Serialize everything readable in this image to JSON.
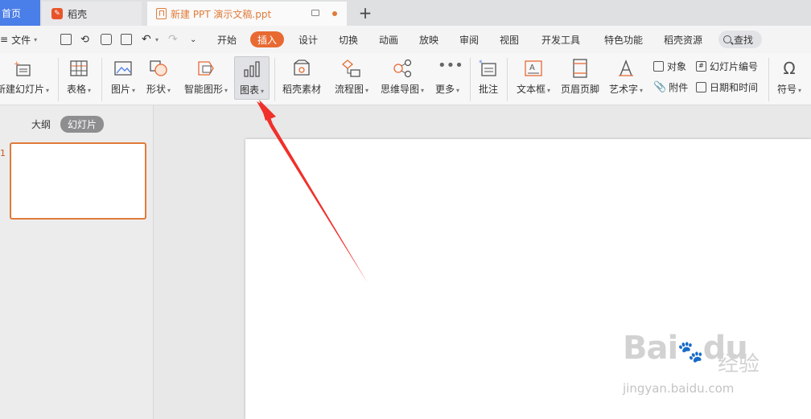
{
  "tabs": {
    "home": "首页",
    "daoke": "稻壳",
    "doc": "新建 PPT 演示文稿.ppt",
    "new_tab": "+"
  },
  "menu": {
    "file": "文件",
    "file_caret": "▾",
    "tabs": [
      "开始",
      "插入",
      "设计",
      "切换",
      "动画",
      "放映",
      "审阅",
      "视图",
      "开发工具",
      "特色功能",
      "稻壳资源"
    ],
    "active_tab": "插入",
    "search": "查找"
  },
  "ribbon": {
    "new_slide": "新建幻灯片",
    "table": "表格",
    "image": "图片",
    "shape": "形状",
    "smart_graphic": "智能图形",
    "chart": "图表",
    "daoke_material": "稻壳素材",
    "flowchart": "流程图",
    "mindmap": "思维导图",
    "more": "更多",
    "comment": "批注",
    "textbox": "文本框",
    "header_footer": "页眉页脚",
    "wordart": "艺术字",
    "object": "对象",
    "attachment": "附件",
    "slide_number": "幻灯片编号",
    "date_time": "日期和时间",
    "symbol": "符号"
  },
  "panel": {
    "outline": "大纲",
    "slides": "幻灯片",
    "slide_num": "1"
  },
  "watermark": {
    "brand": "Bai",
    "brand2": "du",
    "cn": "经验",
    "url": "jingyan.baidu.com"
  },
  "colors": {
    "accent": "#e86a32",
    "home_tab": "#4a7ee8",
    "arrow": "#f0302a"
  }
}
